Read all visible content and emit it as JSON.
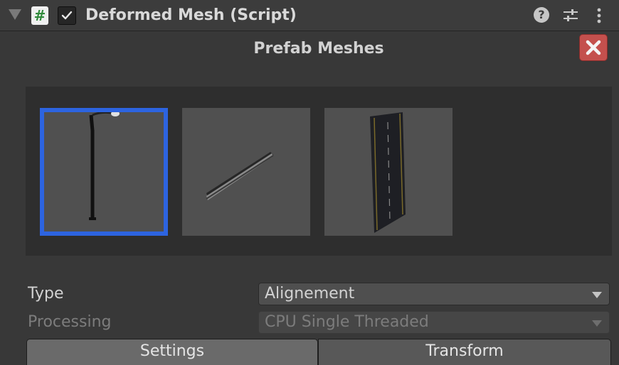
{
  "component": {
    "title": "Deformed Mesh (Script)",
    "script_icon": "#",
    "enabled": true,
    "icons": [
      "foldout-triangle-icon",
      "script-icon",
      "checkbox-icon",
      "help-icon",
      "presets-icon",
      "kebab-menu-icon"
    ]
  },
  "prefab_meshes": {
    "title": "Prefab Meshes",
    "close_icon": "close-icon",
    "items": [
      {
        "name": "street-lamp-mesh",
        "selected": true
      },
      {
        "name": "guardrail-mesh",
        "selected": false
      },
      {
        "name": "road-segment-mesh",
        "selected": false
      }
    ],
    "selection_color": "#2d64e0"
  },
  "fields": {
    "type": {
      "label": "Type",
      "value": "Alignement"
    },
    "processing": {
      "label": "Processing",
      "value": "CPU Single Threaded",
      "disabled": true
    }
  },
  "tabs": [
    {
      "label": "Settings",
      "active": true
    },
    {
      "label": "Transform",
      "active": false
    }
  ],
  "colors": {
    "close_button": "#c4504d",
    "background": "#383838"
  }
}
